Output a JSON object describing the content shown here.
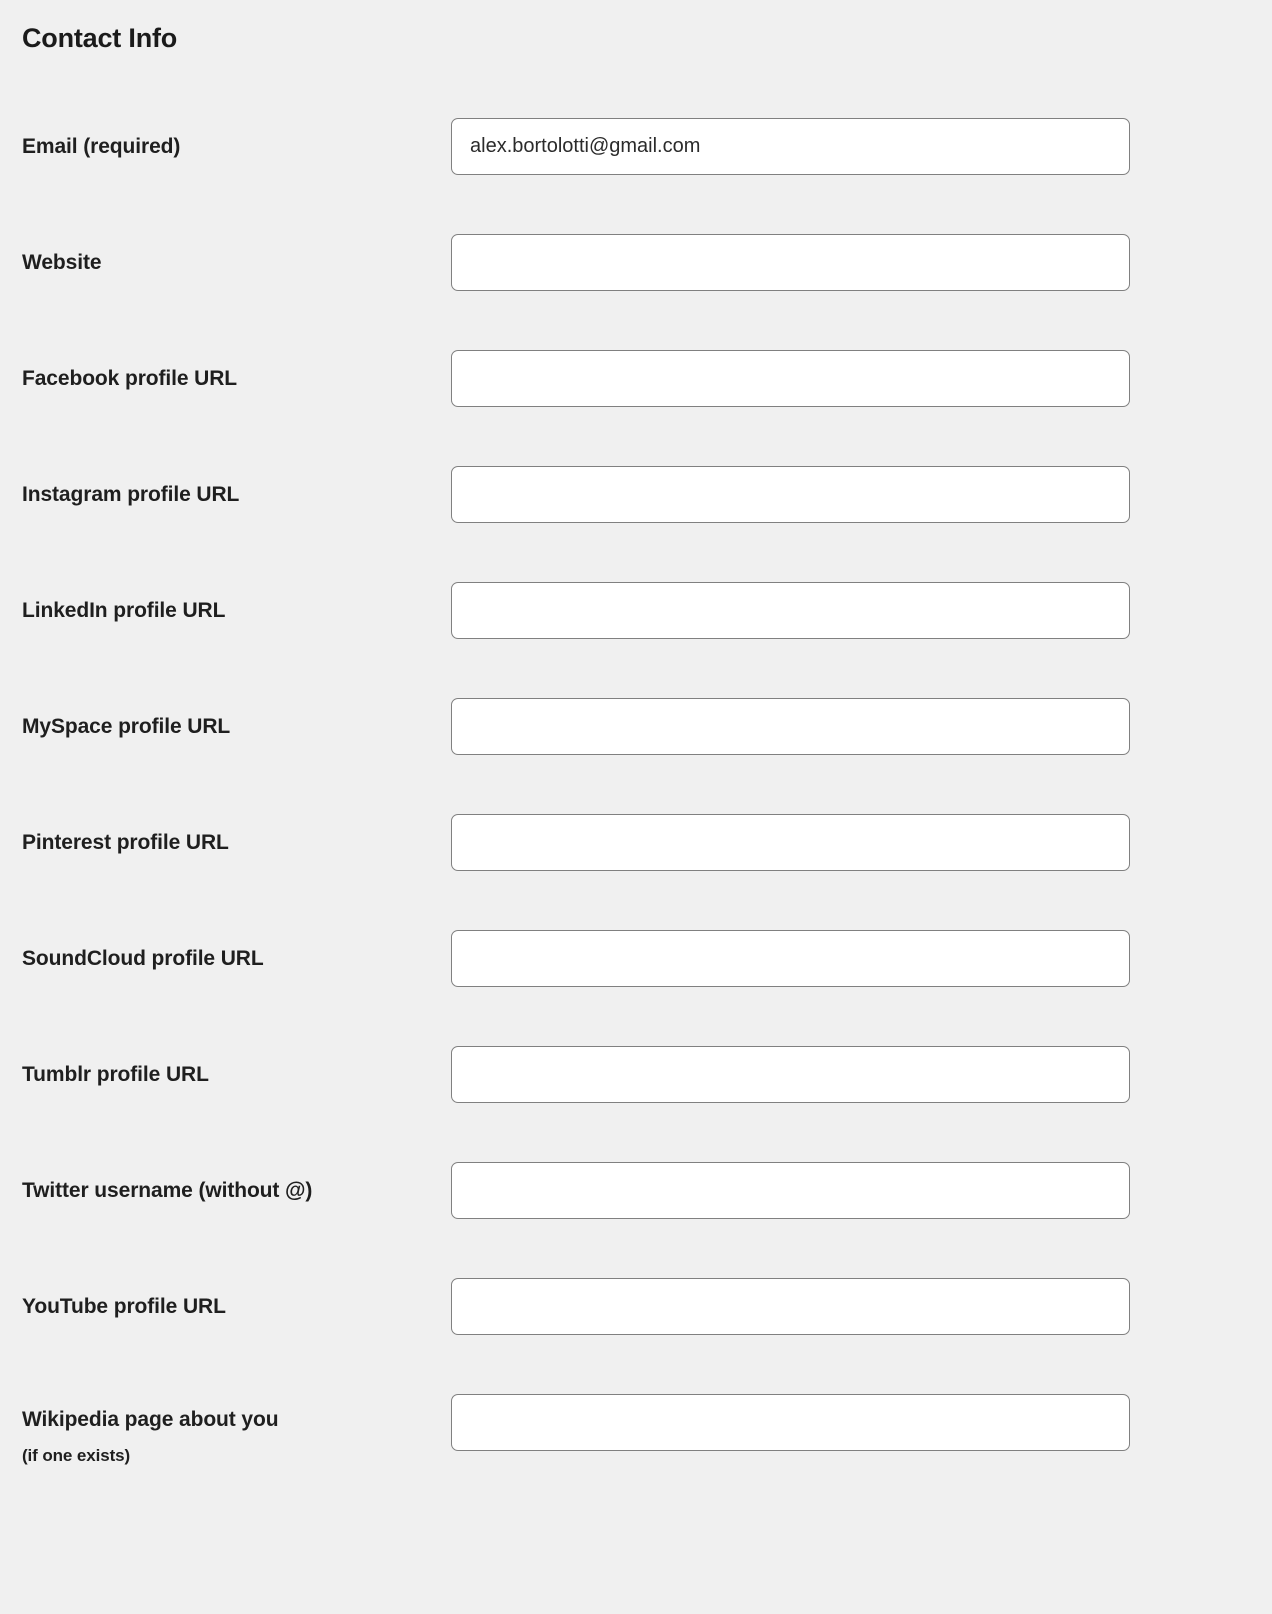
{
  "section": {
    "title": "Contact Info"
  },
  "fields": [
    {
      "label": "Email (required)",
      "value": "alex.bortolotti@gmail.com",
      "placeholder": "",
      "name": "email"
    },
    {
      "label": "Website",
      "value": "",
      "placeholder": "",
      "name": "website"
    },
    {
      "label": "Facebook profile URL",
      "value": "",
      "placeholder": "",
      "name": "facebook"
    },
    {
      "label": "Instagram profile URL",
      "value": "",
      "placeholder": "",
      "name": "instagram"
    },
    {
      "label": "LinkedIn profile URL",
      "value": "",
      "placeholder": "",
      "name": "linkedin"
    },
    {
      "label": "MySpace profile URL",
      "value": "",
      "placeholder": "",
      "name": "myspace"
    },
    {
      "label": "Pinterest profile URL",
      "value": "",
      "placeholder": "",
      "name": "pinterest"
    },
    {
      "label": "SoundCloud profile URL",
      "value": "",
      "placeholder": "",
      "name": "soundcloud"
    },
    {
      "label": "Tumblr profile URL",
      "value": "",
      "placeholder": "",
      "name": "tumblr"
    },
    {
      "label": "Twitter username (without @)",
      "value": "",
      "placeholder": "",
      "name": "twitter"
    },
    {
      "label": "YouTube profile URL",
      "value": "",
      "placeholder": "",
      "name": "youtube"
    },
    {
      "label": "Wikipedia page about you",
      "sublabel": "(if one exists)",
      "value": "",
      "placeholder": "",
      "name": "wikipedia"
    }
  ],
  "colors": {
    "background": "#f0f0f0",
    "input_background": "#ffffff",
    "input_border": "#808080",
    "label_text": "#1f1f1f",
    "value_text": "#2b2b2b"
  }
}
